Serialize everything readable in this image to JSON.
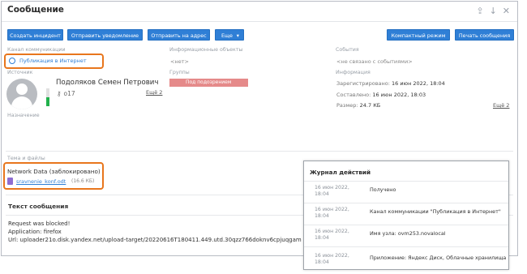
{
  "window": {
    "title": "Сообщение"
  },
  "toolbar": {
    "create_incident": "Создать инцидент",
    "send_notification": "Отправить уведомление",
    "send_to_address": "Отправить на адрес",
    "more": "Еще",
    "compact_mode": "Компактный режим",
    "print_message": "Печать сообщения"
  },
  "channel": {
    "label": "Канал коммуникации",
    "value": "Публикация в Интернет"
  },
  "info_objects": {
    "label": "Информационные объекты",
    "value": "<нет>"
  },
  "events": {
    "label": "События",
    "value": "<не связано с событиями>"
  },
  "source": {
    "label": "Источник",
    "name": "Подоляков Семен Петрович",
    "key_value": "о17",
    "more_link": "Ещё 2"
  },
  "groups": {
    "label": "Группы",
    "badge": "Под подозрением"
  },
  "info": {
    "label": "Информация",
    "registered_label": "Зарегистрировано:",
    "registered_value": "16 июн 2022, 18:04",
    "composed_label": "Составлено:",
    "composed_value": "16 июн 2022, 18:03",
    "size_label": "Размер:",
    "size_value": "24.7 КБ",
    "more_link": "Ещё 2"
  },
  "purpose": {
    "label": "Назначение"
  },
  "attachments": {
    "label": "Тема и файлы",
    "subject": "Network Data (заблокировано)",
    "file_name": "sravnenie_konf.odt",
    "file_size": "(16.6 КБ)"
  },
  "message": {
    "heading": "Текст сообщения",
    "line1": "Request was blocked!",
    "line2": "Application: firefox",
    "line3": "Url: uploader21o.disk.yandex.net/upload-target/20220616T180411.449.utd.30qzz766doknv6cpjuqgam"
  },
  "journal": {
    "title": "Журнал действий",
    "entries": [
      {
        "date": "16 июн 2022, 18:04",
        "text": "Получено"
      },
      {
        "date": "16 июн 2022, 18:04",
        "text": "Канал коммуникации \"Публикация в Интернет\""
      },
      {
        "date": "16 июн 2022, 18:04",
        "text": "Имя узла: ovm253.novalocal"
      },
      {
        "date": "16 июн 2022, 18:04",
        "text": "Приложение: Яндекс Диск, Облачные хранилища"
      }
    ]
  },
  "colors": {
    "accent": "#2f7fd6",
    "highlight": "#e8761d",
    "badge": "#e58a8a",
    "bar": "#22b14c"
  },
  "icons": {
    "window_controls": [
      "export-icon",
      "arrow-down-icon",
      "close-icon"
    ],
    "channel": "globe-icon",
    "key": "key-icon",
    "file": "document-icon"
  }
}
